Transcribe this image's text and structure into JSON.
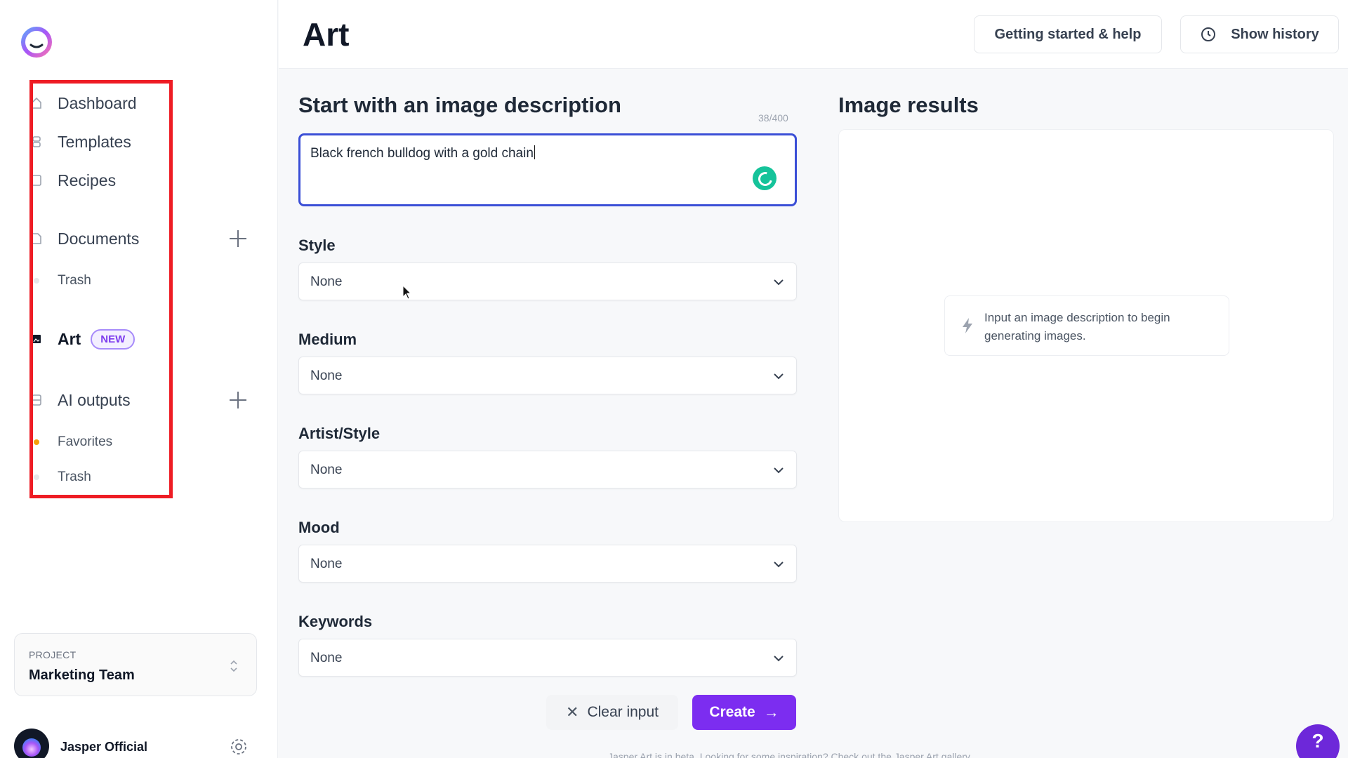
{
  "sidebar": {
    "items": [
      {
        "label": "Dashboard",
        "icon": "home-icon"
      },
      {
        "label": "Templates",
        "icon": "templates-icon"
      },
      {
        "label": "Recipes",
        "icon": "recipes-icon"
      },
      {
        "label": "Documents",
        "icon": "document-icon"
      },
      {
        "label": "Trash",
        "icon": "dot-icon"
      },
      {
        "label": "Art",
        "icon": "image-icon",
        "badge": "NEW"
      },
      {
        "label": "AI outputs",
        "icon": "outputs-icon"
      },
      {
        "label": "Favorites",
        "icon": "dot-icon"
      },
      {
        "label": "Trash",
        "icon": "dot-icon"
      }
    ],
    "project": {
      "kicker": "PROJECT",
      "name": "Marketing Team"
    },
    "user": {
      "name": "Jasper Official"
    }
  },
  "header": {
    "title": "Art",
    "help_label": "Getting started & help",
    "history_label": "Show history"
  },
  "form": {
    "description_title": "Start with an image description",
    "counter": "38/400",
    "description_value": "Black french bulldog with a gold chain",
    "fields": [
      {
        "label": "Style",
        "value": "None"
      },
      {
        "label": "Medium",
        "value": "None"
      },
      {
        "label": "Artist/Style",
        "value": "None"
      },
      {
        "label": "Mood",
        "value": "None"
      },
      {
        "label": "Keywords",
        "value": "None"
      }
    ],
    "clear_label": "Clear input",
    "create_label": "Create",
    "footer_note": "Jasper Art is in beta. Looking for some inspiration? Check out the Jasper Art gallery"
  },
  "results": {
    "title": "Image results",
    "empty_text": "Input an image description to begin generating images."
  },
  "help_fab": "?",
  "colors": {
    "accent": "#7c2df0",
    "highlight_frame": "#ee1c24",
    "focus_border": "#3b4fd6"
  }
}
